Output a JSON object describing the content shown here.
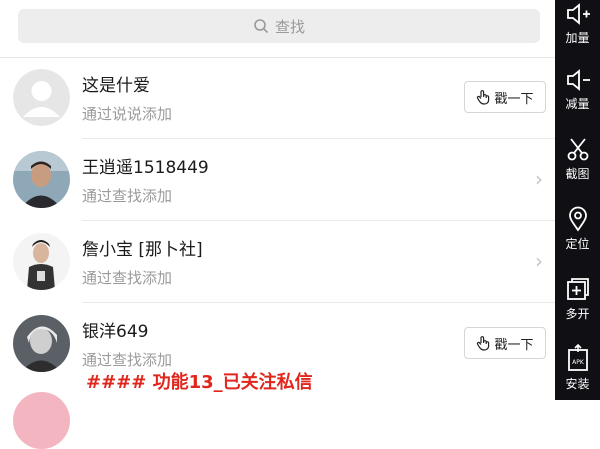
{
  "search": {
    "placeholder": "查找"
  },
  "contacts": [
    {
      "name": "这是什爱",
      "subtitle": "通过说说添加",
      "action": "poke",
      "action_label": "戳一下"
    },
    {
      "name": "王逍遥1518449",
      "subtitle": "通过查找添加",
      "action": "chevron"
    },
    {
      "name": "詹小宝 [那卜社]",
      "subtitle": "通过查找添加",
      "action": "chevron"
    },
    {
      "name": "银洋649",
      "subtitle": "通过查找添加",
      "action": "poke",
      "action_label": "戳一下"
    }
  ],
  "sidebar": {
    "items": [
      {
        "label": "加量",
        "icon": "volume-up-icon"
      },
      {
        "label": "减量",
        "icon": "volume-down-icon"
      },
      {
        "label": "截图",
        "icon": "scissors-icon"
      },
      {
        "label": "定位",
        "icon": "location-pin-icon"
      },
      {
        "label": "多开",
        "icon": "multi-open-icon"
      },
      {
        "label": "安装",
        "icon": "apk-install-icon"
      }
    ]
  },
  "overlay": {
    "caption": "#### 功能13_已关注私信"
  },
  "colors": {
    "accent_red": "#e0271e",
    "sidebar_bg": "#0f0f14"
  }
}
